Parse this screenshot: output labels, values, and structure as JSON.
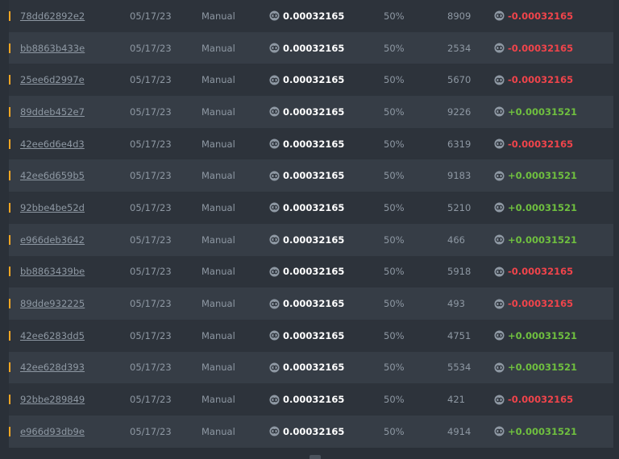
{
  "colors": {
    "marker": "#f5a623",
    "negative": "#f0444b",
    "positive": "#6fbf3f",
    "row_odd": "#2d333b",
    "row_even": "#363d46"
  },
  "icons": {
    "coin": "coin-icon"
  },
  "bets": [
    {
      "id": "78dd62892e2",
      "date": "05/17/23",
      "mode": "Manual",
      "bet": "0.00032165",
      "chance": "50%",
      "roll": "8909",
      "profit": "-0.00032165",
      "sign": "neg"
    },
    {
      "id": "bb8863b433e",
      "date": "05/17/23",
      "mode": "Manual",
      "bet": "0.00032165",
      "chance": "50%",
      "roll": "2534",
      "profit": "-0.00032165",
      "sign": "neg"
    },
    {
      "id": "25ee6d2997e",
      "date": "05/17/23",
      "mode": "Manual",
      "bet": "0.00032165",
      "chance": "50%",
      "roll": "5670",
      "profit": "-0.00032165",
      "sign": "neg"
    },
    {
      "id": "89ddeb452e7",
      "date": "05/17/23",
      "mode": "Manual",
      "bet": "0.00032165",
      "chance": "50%",
      "roll": "9226",
      "profit": "+0.00031521",
      "sign": "pos"
    },
    {
      "id": "42ee6d6e4d3",
      "date": "05/17/23",
      "mode": "Manual",
      "bet": "0.00032165",
      "chance": "50%",
      "roll": "6319",
      "profit": "-0.00032165",
      "sign": "neg"
    },
    {
      "id": "42ee6d659b5",
      "date": "05/17/23",
      "mode": "Manual",
      "bet": "0.00032165",
      "chance": "50%",
      "roll": "9183",
      "profit": "+0.00031521",
      "sign": "pos"
    },
    {
      "id": "92bbe4be52d",
      "date": "05/17/23",
      "mode": "Manual",
      "bet": "0.00032165",
      "chance": "50%",
      "roll": "5210",
      "profit": "+0.00031521",
      "sign": "pos"
    },
    {
      "id": "e966deb3642",
      "date": "05/17/23",
      "mode": "Manual",
      "bet": "0.00032165",
      "chance": "50%",
      "roll": "466",
      "profit": "+0.00031521",
      "sign": "pos"
    },
    {
      "id": "bb8863439be",
      "date": "05/17/23",
      "mode": "Manual",
      "bet": "0.00032165",
      "chance": "50%",
      "roll": "5918",
      "profit": "-0.00032165",
      "sign": "neg"
    },
    {
      "id": "89dde932225",
      "date": "05/17/23",
      "mode": "Manual",
      "bet": "0.00032165",
      "chance": "50%",
      "roll": "493",
      "profit": "-0.00032165",
      "sign": "neg"
    },
    {
      "id": "42ee6283dd5",
      "date": "05/17/23",
      "mode": "Manual",
      "bet": "0.00032165",
      "chance": "50%",
      "roll": "4751",
      "profit": "+0.00031521",
      "sign": "pos"
    },
    {
      "id": "42ee628d393",
      "date": "05/17/23",
      "mode": "Manual",
      "bet": "0.00032165",
      "chance": "50%",
      "roll": "5534",
      "profit": "+0.00031521",
      "sign": "pos"
    },
    {
      "id": "92bbe289849",
      "date": "05/17/23",
      "mode": "Manual",
      "bet": "0.00032165",
      "chance": "50%",
      "roll": "421",
      "profit": "-0.00032165",
      "sign": "neg"
    },
    {
      "id": "e966d93db9e",
      "date": "05/17/23",
      "mode": "Manual",
      "bet": "0.00032165",
      "chance": "50%",
      "roll": "4914",
      "profit": "+0.00031521",
      "sign": "pos"
    }
  ]
}
